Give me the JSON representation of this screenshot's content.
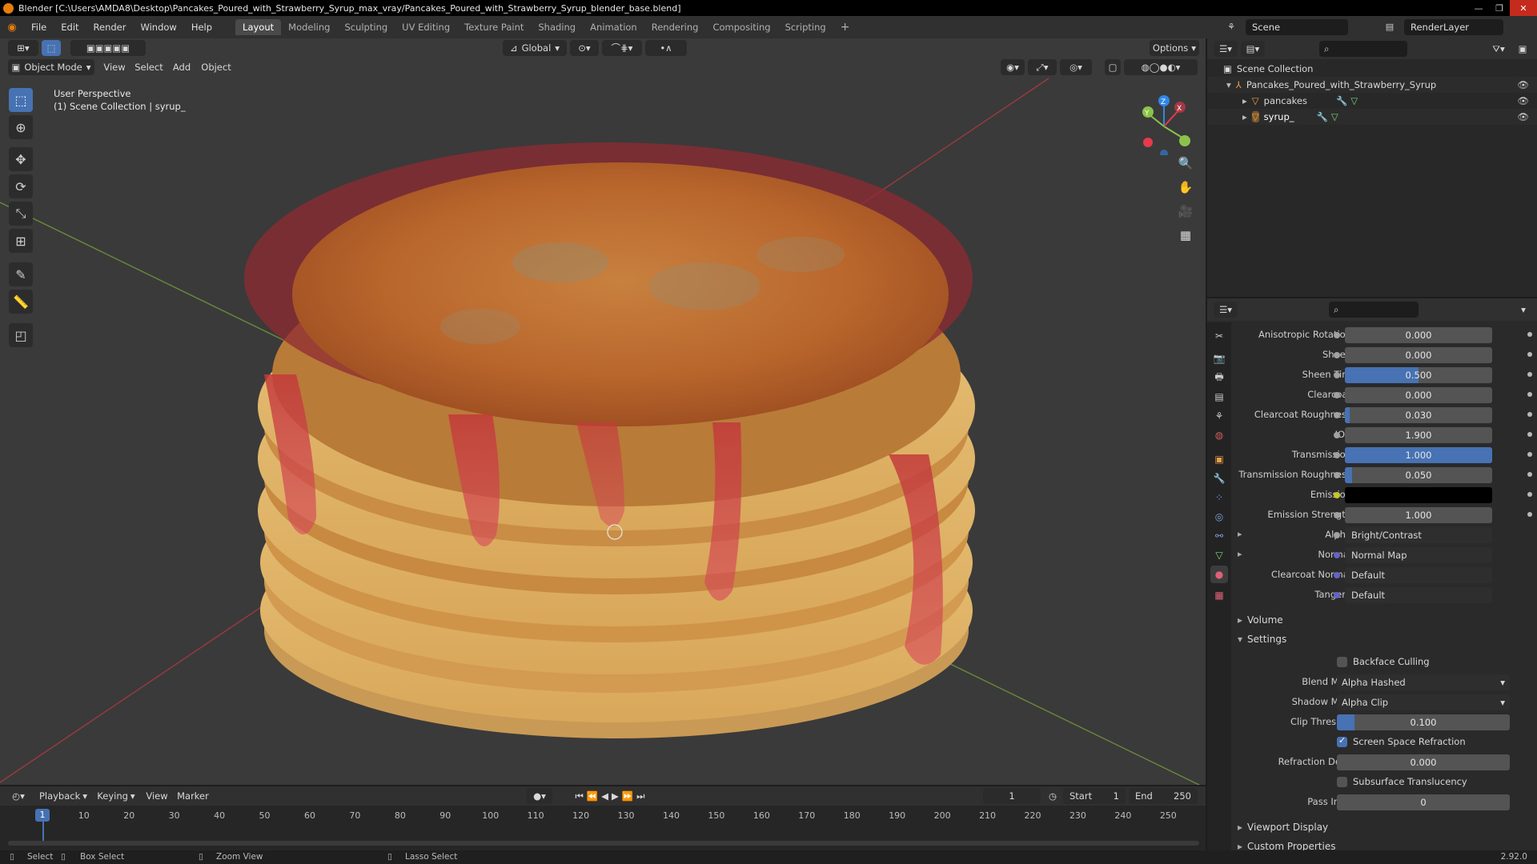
{
  "titlebar": {
    "title": "Blender [C:\\Users\\AMDA8\\Desktop\\Pancakes_Poured_with_Strawberry_Syrup_max_vray/Pancakes_Poured_with_Strawberry_Syrup_blender_base.blend]"
  },
  "menus": [
    "File",
    "Edit",
    "Render",
    "Window",
    "Help"
  ],
  "workspaces": [
    "Layout",
    "Modeling",
    "Sculpting",
    "UV Editing",
    "Texture Paint",
    "Shading",
    "Animation",
    "Rendering",
    "Compositing",
    "Scripting"
  ],
  "active_workspace": "Layout",
  "scene": {
    "name": "Scene",
    "view_layer": "RenderLayer"
  },
  "viewport": {
    "mode": "Object Mode",
    "menus": [
      "View",
      "Select",
      "Add",
      "Object"
    ],
    "transform_orientation": "Global",
    "options_label": "Options",
    "overlay_line1": "User Perspective",
    "overlay_line2": "(1) Scene Collection | syrup_",
    "gizmo_axes": [
      "X",
      "Y",
      "Z"
    ]
  },
  "outliner": {
    "root": "Scene Collection",
    "collection": "Pancakes_Poured_with_Strawberry_Syrup",
    "objects": [
      "pancakes",
      "syrup_"
    ]
  },
  "properties": {
    "rows": [
      {
        "label": "Anisotropic Rotation",
        "value": "0.000",
        "fill": 0
      },
      {
        "label": "Sheen",
        "value": "0.000",
        "fill": 0
      },
      {
        "label": "Sheen Tint",
        "value": "0.500",
        "fill": 0.5
      },
      {
        "label": "Clearcoat",
        "value": "0.000",
        "fill": 0
      },
      {
        "label": "Clearcoat Roughness",
        "value": "0.030",
        "fill": 0.03
      },
      {
        "label": "IOR",
        "value": "1.900",
        "fill": 0
      },
      {
        "label": "Transmission",
        "value": "1.000",
        "fill": 1.0
      },
      {
        "label": "Transmission Roughness",
        "value": "0.050",
        "fill": 0.05
      },
      {
        "label": "Emission",
        "value": "",
        "color": "#000000"
      },
      {
        "label": "Emission Strength",
        "value": "1.000",
        "fill": 0
      }
    ],
    "links": [
      {
        "label": "Alpha",
        "value": "Bright/Contrast"
      },
      {
        "label": "Normal",
        "value": "Normal Map"
      },
      {
        "label": "Clearcoat Normal",
        "value": "Default"
      },
      {
        "label": "Tangent",
        "value": "Default"
      }
    ],
    "sections": {
      "volume": "Volume",
      "settings": "Settings",
      "viewport_display": "Viewport Display",
      "custom_properties": "Custom Properties"
    },
    "settings": {
      "backface_culling": {
        "label": "Backface Culling",
        "checked": false
      },
      "blend_mode": {
        "label": "Blend Mode",
        "value": "Alpha Hashed"
      },
      "shadow_mode": {
        "label": "Shadow Mode",
        "value": "Alpha Clip"
      },
      "clip_threshold": {
        "label": "Clip Threshold",
        "value": "0.100",
        "fill": 0.1
      },
      "screen_space_refraction": {
        "label": "Screen Space Refraction",
        "checked": true
      },
      "refraction_depth": {
        "label": "Refraction Depth",
        "value": "0.000"
      },
      "subsurface_translucency": {
        "label": "Subsurface Translucency",
        "checked": false
      },
      "pass_index": {
        "label": "Pass Index",
        "value": "0"
      }
    }
  },
  "timeline": {
    "menus": [
      "Playback",
      "Keying",
      "View",
      "Marker"
    ],
    "current_frame": "1",
    "start_label": "Start",
    "start": "1",
    "end_label": "End",
    "end": "250",
    "ticks": [
      "1",
      "10",
      "20",
      "30",
      "40",
      "50",
      "60",
      "70",
      "80",
      "90",
      "100",
      "110",
      "120",
      "130",
      "140",
      "150",
      "160",
      "170",
      "180",
      "190",
      "200",
      "210",
      "220",
      "230",
      "240",
      "250"
    ]
  },
  "statusbar": {
    "select": "Select",
    "box_select": "Box Select",
    "zoom_view": "Zoom View",
    "lasso_select": "Lasso Select",
    "version": "2.92.0"
  },
  "colors": {
    "accent": "#4772b3",
    "x_axis": "#e8394d",
    "y_axis": "#8bc34a",
    "z_axis": "#2f86e8"
  }
}
